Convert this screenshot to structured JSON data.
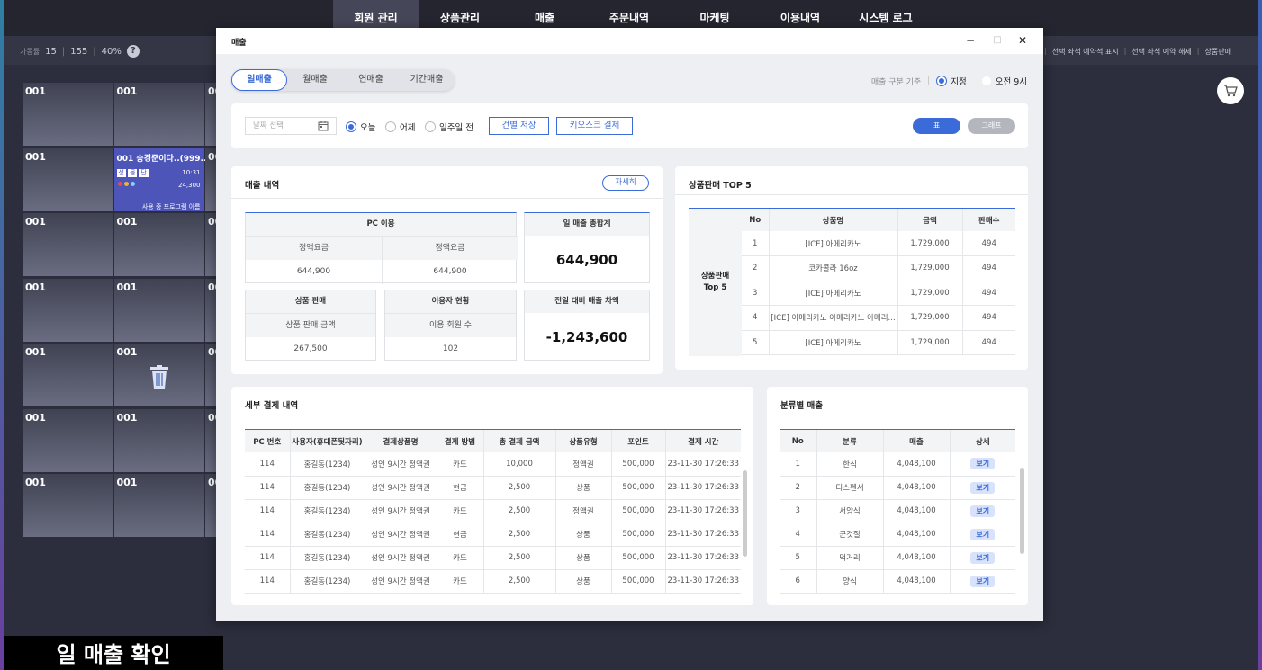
{
  "nav": {
    "items": [
      "회원 관리",
      "상품관리",
      "매출",
      "주문내역",
      "마케팅",
      "이용내역",
      "시스템 로그"
    ]
  },
  "seat_info": {
    "label": "가동률",
    "used": "15",
    "total": "155",
    "percent": "40%"
  },
  "right_menu": [
    "선택 좌석 예약석 표시",
    "선택 좌석 예약 해제",
    "상품판매"
  ],
  "grid": {
    "cell_label": "001",
    "active": {
      "user": "001 송경준이다..(999..)",
      "tags": [
        "성",
        "몰",
        "단"
      ],
      "time": "10:31",
      "price": "24,300",
      "program": "사용 중 프로그램 이름"
    }
  },
  "caption": "일 매출 확인",
  "modal": {
    "title": "매출",
    "tabs": [
      "일매출",
      "월매출",
      "연매출",
      "기간매출"
    ],
    "basis": {
      "label": "매출 구분 기준",
      "options": [
        "지정",
        "오전 9시"
      ]
    },
    "filter": {
      "date_placeholder": "날짜 선택",
      "options": [
        "오늘",
        "어제",
        "일주일 전"
      ],
      "save_button": "건별 저장",
      "kiosk_button": "키오스크 결제",
      "table_button": "표",
      "graph_button": "그래프"
    },
    "sales": {
      "title": "매출 내역",
      "detail_button": "자세히",
      "pc_usage": "PC 이용",
      "fixed_fee_label": "정액요금",
      "fixed_fee_value": "644,900",
      "fixed_fee_label2": "정액요금",
      "fixed_fee_value2": "644,900",
      "daily_total_label": "일 매출 총합계",
      "daily_total_value": "644,900",
      "product_sales": "상품 판매",
      "product_sales_amount_label": "상품 판매 금액",
      "product_sales_amount": "267,500",
      "user_status": "이용자 현황",
      "member_count_label": "이용 회원 수",
      "member_count": "102",
      "prev_diff_label": "전일 대비 매출 차액",
      "prev_diff_value": "-1,243,600"
    },
    "top5": {
      "title": "상품판매 TOP 5",
      "side_label": [
        "상품판매",
        "Top 5"
      ],
      "columns": [
        "No",
        "상품명",
        "금액",
        "판매수"
      ],
      "rows": [
        [
          "1",
          "[ICE] 아메리카노",
          "1,729,000",
          "494"
        ],
        [
          "2",
          "코카콜라 16oz",
          "1,729,000",
          "494"
        ],
        [
          "3",
          "[ICE] 아메리카노",
          "1,729,000",
          "494"
        ],
        [
          "4",
          "[ICE] 아메리카노 아메리카노 아메리...",
          "1,729,000",
          "494"
        ],
        [
          "5",
          "[ICE] 아메리카노",
          "1,729,000",
          "494"
        ]
      ]
    },
    "payments": {
      "title": "세부 결제 내역",
      "columns": [
        "PC 번호",
        "사용자(휴대폰뒷자리)",
        "결제상품명",
        "결제 방법",
        "총 결제 금액",
        "상품유형",
        "포인트",
        "결제 시간"
      ],
      "rows": [
        [
          "114",
          "홍길동(1234)",
          "성인 9시간 정액권",
          "카드",
          "10,000",
          "정액권",
          "500,000",
          "23-11-30 17:26:33"
        ],
        [
          "114",
          "홍길동(1234)",
          "성인 9시간 정액권",
          "현금",
          "2,500",
          "상품",
          "500,000",
          "23-11-30 17:26:33"
        ],
        [
          "114",
          "홍길동(1234)",
          "성인 9시간 정액권",
          "카드",
          "2,500",
          "정액권",
          "500,000",
          "23-11-30 17:26:33"
        ],
        [
          "114",
          "홍길동(1234)",
          "성인 9시간 정액권",
          "현금",
          "2,500",
          "상품",
          "500,000",
          "23-11-30 17:26:33"
        ],
        [
          "114",
          "홍길동(1234)",
          "성인 9시간 정액권",
          "카드",
          "2,500",
          "상품",
          "500,000",
          "23-11-30 17:26:33"
        ],
        [
          "114",
          "홍길동(1234)",
          "성인 9시간 정액권",
          "카드",
          "2,500",
          "상품",
          "500,000",
          "23-11-30 17:26:33"
        ]
      ]
    },
    "category": {
      "title": "분류별 매출",
      "columns": [
        "No",
        "분류",
        "매출",
        "상세"
      ],
      "view_label": "보기",
      "rows": [
        [
          "1",
          "한식",
          "4,048,100"
        ],
        [
          "2",
          "디스펜서",
          "4,048,100"
        ],
        [
          "3",
          "서양식",
          "4,048,100"
        ],
        [
          "4",
          "군것질",
          "4,048,100"
        ],
        [
          "5",
          "먹거리",
          "4,048,100"
        ],
        [
          "6",
          "양식",
          "4,048,100"
        ]
      ]
    }
  },
  "colors": {
    "accent": "#3a6bd8",
    "graph_button": "#b4b6be",
    "nav_bg": "#24252f",
    "seat_active": "#4d55b8"
  }
}
